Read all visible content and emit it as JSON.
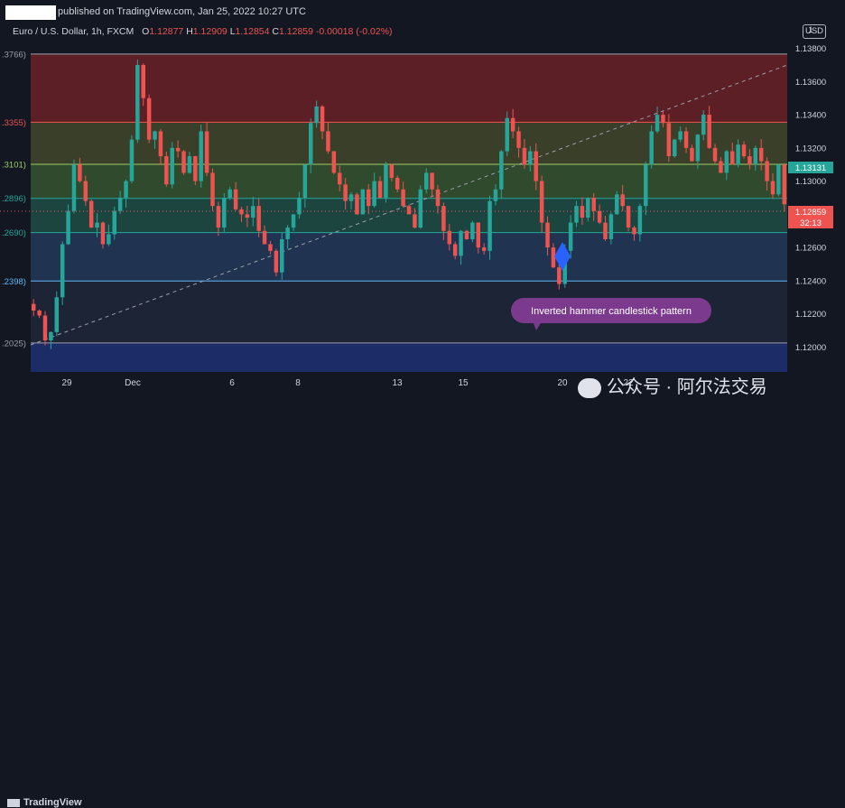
{
  "header": {
    "published": "published on TradingView.com, Jan 25, 2022 10:27 UTC",
    "symbol": "Euro / U.S. Dollar, 1h, FXCM",
    "ohlc": {
      "o_label": "O",
      "o": "1.12877",
      "h_label": "H",
      "h": "1.12909",
      "l_label": "L",
      "l": "1.12854",
      "c_label": "C",
      "c": "1.12859",
      "change": "-0.00018 (-0.02%)"
    },
    "currency_button": "USD"
  },
  "footer": {
    "brand": "TradingView",
    "watermark": "公众号 · 阿尔法交易"
  },
  "annotation": {
    "text": "Inverted hammer candlestick pattern"
  },
  "price_labels": {
    "last_price": "1.13131",
    "current_price": "1.12859",
    "countdown": "32:13"
  },
  "colors": {
    "background": "#131722",
    "up": "#26a69a",
    "down": "#ef5350",
    "annotation_bubble": "#7b3a8e",
    "marker": "#2962ff"
  },
  "chart_data": {
    "type": "candlestick",
    "title": "",
    "xlabel": "",
    "ylabel": "",
    "x_tick_labels": [
      "29",
      "Dec",
      "6",
      "8",
      "13",
      "15",
      "20",
      "22"
    ],
    "y_ticks": [
      "1.12000",
      "1.12200",
      "1.12400",
      "1.12600",
      "1.12800",
      "1.13000",
      "1.13200",
      "1.13400",
      "1.13600",
      "1.13800"
    ],
    "y_top_label": "1",
    "ylim": [
      1.1185,
      1.1395
    ],
    "fib_levels": [
      {
        "label": ".3766)",
        "price": 1.13766,
        "color": "#9b9ea8"
      },
      {
        "label": ".3355)",
        "price": 1.13355,
        "color": "#ef5350"
      },
      {
        "label": ".3101)",
        "price": 1.13101,
        "color": "#9ccc65"
      },
      {
        "label": ".2896)",
        "price": 1.12896,
        "color": "#26a69a"
      },
      {
        "label": ".2690)",
        "price": 1.1269,
        "color": "#26a69a"
      },
      {
        "label": ".2398)",
        "price": 1.12398,
        "color": "#64b5f6"
      },
      {
        "label": ".2025)",
        "price": 1.12025,
        "color": "#9b9ea8"
      }
    ],
    "fib_zones": [
      {
        "from": 1.13766,
        "to": 1.13355,
        "color": "#5c1f26"
      },
      {
        "from": 1.13355,
        "to": 1.13101,
        "color": "#3a3f2a"
      },
      {
        "from": 1.13101,
        "to": 1.12896,
        "color": "#2f4a2c"
      },
      {
        "from": 1.12896,
        "to": 1.1269,
        "color": "#1d4540"
      },
      {
        "from": 1.1269,
        "to": 1.12398,
        "color": "#203451"
      },
      {
        "from": 1.12398,
        "to": 1.12025,
        "color": "#1c2436"
      },
      {
        "from": 1.12025,
        "to": 1.1185,
        "color": "#1c2c66"
      }
    ],
    "candle_closes": [
      1.1222,
      1.1219,
      1.1204,
      1.1209,
      1.123,
      1.1262,
      1.1282,
      1.131,
      1.13,
      1.1288,
      1.1272,
      1.1275,
      1.1262,
      1.1268,
      1.1282,
      1.129,
      1.13,
      1.1325,
      1.137,
      1.135,
      1.1325,
      1.133,
      1.1315,
      1.1298,
      1.132,
      1.1318,
      1.1305,
      1.1315,
      1.13,
      1.133,
      1.1305,
      1.1285,
      1.1272,
      1.129,
      1.1295,
      1.1283,
      1.128,
      1.1278,
      1.1285,
      1.127,
      1.1262,
      1.1258,
      1.1245,
      1.1265,
      1.1272,
      1.128,
      1.129,
      1.131,
      1.1335,
      1.1345,
      1.133,
      1.1318,
      1.1305,
      1.1298,
      1.1288,
      1.1292,
      1.128,
      1.1295,
      1.1285,
      1.13,
      1.129,
      1.131,
      1.1302,
      1.1295,
      1.1285,
      1.128,
      1.1272,
      1.1295,
      1.1305,
      1.1295,
      1.1285,
      1.127,
      1.1262,
      1.1255,
      1.127,
      1.1265,
      1.1275,
      1.126,
      1.1258,
      1.1288,
      1.1295,
      1.1318,
      1.1338,
      1.133,
      1.132,
      1.131,
      1.1318,
      1.13,
      1.1275,
      1.126,
      1.1248,
      1.1238,
      1.1258,
      1.1275,
      1.1285,
      1.1278,
      1.129,
      1.1282,
      1.1275,
      1.1265,
      1.128,
      1.1292,
      1.1285,
      1.1272,
      1.1268,
      1.1285,
      1.131,
      1.133,
      1.134,
      1.1335,
      1.1315,
      1.1325,
      1.133,
      1.132,
      1.1312,
      1.1328,
      1.134,
      1.132,
      1.1312,
      1.1305,
      1.1318,
      1.131,
      1.1322,
      1.1315,
      1.131,
      1.132,
      1.1312,
      1.13,
      1.1292,
      1.131,
      1.1286
    ]
  }
}
